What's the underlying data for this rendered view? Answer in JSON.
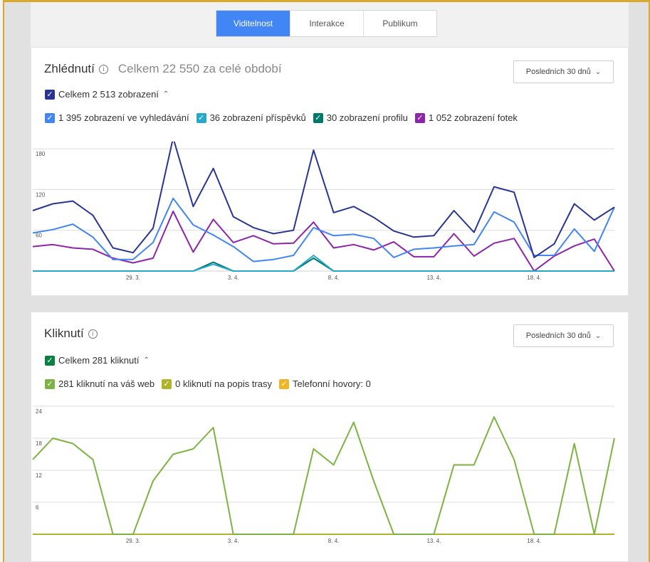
{
  "tabs": [
    {
      "label": "Viditelnost",
      "active": true
    },
    {
      "label": "Interakce",
      "active": false
    },
    {
      "label": "Publikum",
      "active": false
    }
  ],
  "views": {
    "title": "Zhlédnutí",
    "info_icon": "info-icon",
    "subtitle": "Celkem 22 550 za celé období",
    "period": "Posledních 30 dnů",
    "total_label": "Celkem 2 513 zobrazení",
    "legend": [
      {
        "label": "1 395 zobrazení ve vyhledávání",
        "color": "#4285f4"
      },
      {
        "label": "36 zobrazení příspěvků",
        "color": "#26a9c9"
      },
      {
        "label": "30 zobrazení profilu",
        "color": "#00796b"
      },
      {
        "label": "1 052 zobrazení fotek",
        "color": "#8e24aa"
      }
    ],
    "total_color": "#283593"
  },
  "clicks": {
    "title": "Kliknutí",
    "info_icon": "info-icon",
    "period": "Posledních 30 dnů",
    "total_label": "Celkem 281 kliknutí",
    "total_color": "#0b8043",
    "legend": [
      {
        "label": "281 kliknutí na váš web",
        "color": "#7cb342"
      },
      {
        "label": "0 kliknutí na popis trasy",
        "color": "#afb42b"
      },
      {
        "label": "Telefonní hovory: 0",
        "color": "#f0b429"
      }
    ]
  },
  "chart_data": [
    {
      "type": "line",
      "x_ticks": [
        "29. 3.",
        "3. 4.",
        "8. 4.",
        "13. 4.",
        "18. 4."
      ],
      "y_ticks": [
        "180",
        "120",
        "60"
      ],
      "ylim": [
        0,
        200
      ],
      "series": [
        {
          "name": "Celkem 2 513 zobrazení",
          "color": "#283593",
          "values": [
            89,
            99,
            103,
            82,
            34,
            27,
            63,
            196,
            95,
            151,
            80,
            64,
            55,
            60,
            178,
            86,
            95,
            79,
            59,
            50,
            52,
            89,
            57,
            124,
            116,
            20,
            40,
            99,
            75,
            94
          ]
        },
        {
          "name": "1 395 zobrazení ve vyhledávání",
          "color": "#4285f4",
          "values": [
            56,
            61,
            69,
            50,
            17,
            17,
            42,
            107,
            68,
            53,
            36,
            14,
            17,
            23,
            64,
            52,
            54,
            48,
            20,
            32,
            34,
            37,
            39,
            87,
            72,
            23,
            23,
            62,
            29,
            94
          ]
        },
        {
          "name": "36 zobrazení příspěvků",
          "color": "#26a9c9",
          "values": [
            0,
            0,
            0,
            0,
            0,
            0,
            0,
            0,
            0,
            10,
            0,
            0,
            0,
            0,
            23,
            0,
            0,
            0,
            0,
            0,
            0,
            0,
            0,
            0,
            0,
            0,
            0,
            0,
            0,
            0
          ]
        },
        {
          "name": "30 zobrazení profilu",
          "color": "#00796b",
          "values": [
            0,
            0,
            0,
            0,
            0,
            0,
            0,
            0,
            0,
            13,
            0,
            0,
            0,
            0,
            19,
            0,
            0,
            0,
            0,
            0,
            0,
            0,
            0,
            0,
            0,
            0,
            0,
            0,
            0,
            0
          ]
        },
        {
          "name": "1 052 zobrazení fotek",
          "color": "#8e24aa",
          "values": [
            36,
            39,
            34,
            32,
            19,
            12,
            19,
            88,
            28,
            76,
            42,
            52,
            40,
            41,
            72,
            34,
            39,
            31,
            43,
            21,
            21,
            55,
            22,
            41,
            48,
            0,
            22,
            37,
            47,
            0
          ]
        }
      ]
    },
    {
      "type": "line",
      "x_ticks": [
        "29. 3.",
        "3. 4.",
        "8. 4.",
        "13. 4.",
        "18. 4."
      ],
      "y_ticks": [
        "24",
        "18",
        "12",
        "6"
      ],
      "ylim": [
        0,
        24
      ],
      "series": [
        {
          "name": "281 kliknutí na váš web",
          "color": "#7cb342",
          "values": [
            14,
            18,
            17,
            14,
            0,
            0,
            10,
            15,
            16,
            20,
            0,
            0,
            0,
            0,
            16,
            13,
            21,
            10,
            0,
            0,
            0,
            13,
            13,
            22,
            14,
            0,
            0,
            17,
            0,
            18
          ]
        },
        {
          "name": "0 kliknutí na popis trasy",
          "color": "#afb42b",
          "values": [
            0,
            0,
            0,
            0,
            0,
            0,
            0,
            0,
            0,
            0,
            0,
            0,
            0,
            0,
            0,
            0,
            0,
            0,
            0,
            0,
            0,
            0,
            0,
            0,
            0,
            0,
            0,
            0,
            0,
            0
          ]
        },
        {
          "name": "Telefonní hovory: 0",
          "color": "#f0b429",
          "values": [
            0,
            0,
            0,
            0,
            0,
            0,
            0,
            0,
            0,
            0,
            0,
            0,
            0,
            0,
            0,
            0,
            0,
            0,
            0,
            0,
            0,
            0,
            0,
            0,
            0,
            0,
            0,
            0,
            0,
            0
          ]
        }
      ]
    }
  ]
}
